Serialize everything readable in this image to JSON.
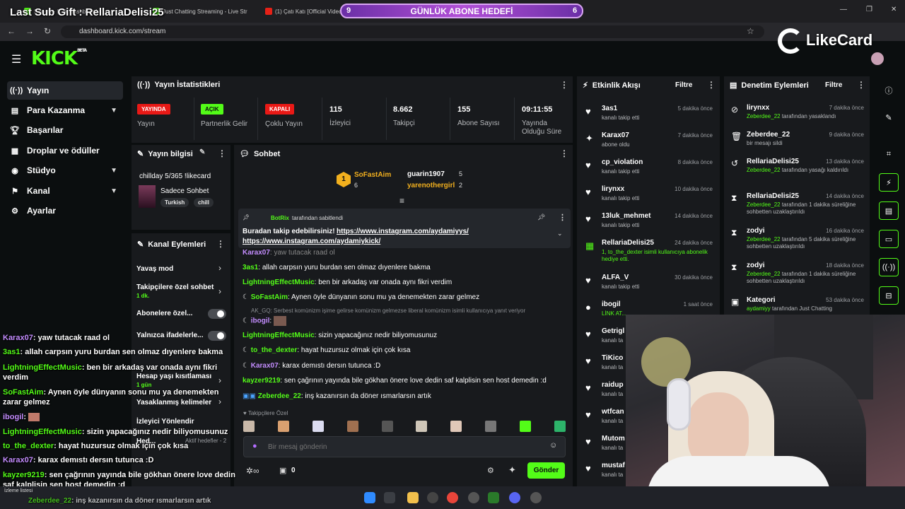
{
  "overlay": {
    "title": "Last Sub Gift : RellariaDelisi25",
    "goal_label": "GÜNLÜK ABONE HEDEFİ",
    "goal_current": "9",
    "goal_target": "6",
    "brand": "LikeCard"
  },
  "browser": {
    "tabs": [
      "Stream · Kick Dashboard",
      "Just Chatting Streaming - Live Str",
      "(1) Çatı Katı [Official Video]"
    ],
    "url": "dashboard.kick.com/stream"
  },
  "sidebar": {
    "items": [
      {
        "label": "Yayın",
        "icon": "broadcast-icon"
      },
      {
        "label": "Para Kazanma",
        "icon": "money-icon"
      },
      {
        "label": "Başarılar",
        "icon": "trophy-icon"
      },
      {
        "label": "Droplar ve ödüller",
        "icon": "gift-icon"
      },
      {
        "label": "Stüdyo",
        "icon": "studio-icon"
      },
      {
        "label": "Kanal",
        "icon": "channel-icon"
      },
      {
        "label": "Ayarlar",
        "icon": "gear-icon"
      }
    ]
  },
  "stats": {
    "title": "Yayın İstatistikleri",
    "items": [
      {
        "badge": "YAYINDA",
        "label": "Yayın",
        "color": "#e91916"
      },
      {
        "badge": "AÇIK",
        "label": "Partnerlik Gelir",
        "color": "#53fc18"
      },
      {
        "badge": "KAPALI",
        "label": "Çoklu Yayın",
        "color": "#e91916"
      },
      {
        "value": "115",
        "label": "İzleyici"
      },
      {
        "value": "8.662",
        "label": "Takipçi"
      },
      {
        "value": "155",
        "label": "Abone Sayısı"
      },
      {
        "value": "09:11:55",
        "label": "Yayında Olduğu Süre"
      }
    ]
  },
  "stream_info": {
    "title": "Yayın bilgisi",
    "stream_title": "chillday 5/365 !likecard",
    "category": "Sadece Sohbet",
    "tags": [
      "Turkish",
      "chill"
    ]
  },
  "channel_actions": {
    "title": "Kanal Eylemleri",
    "rows": [
      "Yavaş mod",
      "Takipçilere özel sohbet",
      "1 dk.",
      "Abonelere özel...",
      "Yalnızca ifadelerle...",
      "Hesap yaşı kısıtlaması",
      "1 gün",
      "Yasaklanmış kelimeler",
      "İzleyici Yönlendir",
      "Hed...",
      "Aktif hedefler - 2"
    ]
  },
  "chat": {
    "title": "Sohbet",
    "top_gifters": [
      {
        "name": "SoFastAim",
        "count": "6"
      },
      {
        "name": "guarin1907",
        "count": "5"
      },
      {
        "name": "yarenothergirl",
        "count": "2"
      }
    ],
    "pinned_by": "BotRix",
    "pinned_suffix": "tarafından sabitlendi",
    "pinned_text": "Buradan takip edebilirsiniz!",
    "pinned_link1": "https://www.instagram.com/aydamiyys/",
    "pinned_link2": "https://www.instagram.com/aydamiykick/",
    "messages": [
      {
        "user": "Karax07",
        "text": "yaw tutacak raad ol",
        "color": "#c48dff"
      },
      {
        "user": "3as1",
        "text": "allah carpsın yuru burdan sen olmaz dıyenlere bakma",
        "color": "#53fc18"
      },
      {
        "user": "LightningEffectMusic",
        "text": "ben bir arkadaş var onada aynı fikri verdim",
        "color": "#53fc18"
      },
      {
        "user": "SoFastAim",
        "text": "Aynen öyle dünyanın sonu mu ya denemekten zarar gelmez",
        "color": "#53fc18"
      },
      {
        "user": "AK_GQ",
        "text": "Serbest komünizm işime gelirse komünizm gelmezse liberal komünizm isimli kullanıcıya yanıt veriyor",
        "color": "#8a8d91"
      },
      {
        "user": "ibogil",
        "text": "",
        "color": "#c48dff"
      },
      {
        "user": "LightningEffectMusic",
        "text": "sizin yapacağınız nedir biliyomusunuz",
        "color": "#53fc18"
      },
      {
        "user": "to_the_dexter",
        "text": "hayat huzursuz olmak için çok kısa",
        "color": "#53fc18"
      },
      {
        "user": "Karax07",
        "text": "karax demıstı dersın tutunca :D",
        "color": "#c48dff"
      },
      {
        "user": "kayzer9219",
        "text": "sen çağrının yayında bile gökhan önere love dedin saf kalplisin sen host demedin :d",
        "color": "#53fc18"
      },
      {
        "user": "Zeberdee_22",
        "text": "inş kazanırsın da döner ısmarlarsın artık",
        "color": "#53fc18"
      }
    ],
    "followers_only": "Takipçilere Özel",
    "input_placeholder": "Bir mesaj gönderin",
    "points": "0",
    "send_label": "Gönder"
  },
  "overlay_chat": [
    {
      "user": "Karax07",
      "text": "yaw tutacak raad ol",
      "color": "#c48dff"
    },
    {
      "user": "3as1",
      "text": "allah carpsın yuru burdan sen olmaz dıyenlere bakma",
      "color": "#53fc18"
    },
    {
      "user": "LightningEffectMusic",
      "text": "ben bir arkadaş var onada aynı fikri verdim",
      "color": "#53fc18"
    },
    {
      "user": "SoFastAim",
      "text": "Aynen öyle dünyanın sonu mu ya denemekten zarar gelmez",
      "color": "#53fc18"
    },
    {
      "user": "ibogil",
      "text": "",
      "color": "#c48dff"
    },
    {
      "user": "LightningEffectMusic",
      "text": "sizin yapacağınız nedir biliyomusunuz",
      "color": "#53fc18"
    },
    {
      "user": "to_the_dexter",
      "text": "hayat huzursuz olmak için çok kısa",
      "color": "#53fc18"
    },
    {
      "user": "Karax07",
      "text": "karax demıstı dersın tutunca :D",
      "color": "#c48dff"
    },
    {
      "user": "kayzer9219",
      "text": "sen çağrının yayında bile gökhan önere love dedin saf kalplisin sen host demedin :d",
      "color": "#53fc18"
    },
    {
      "user": "Zeberdee_22",
      "text": "inş kazanırsın da döner ısmarlarsın artık",
      "color": "#53fc18"
    }
  ],
  "activity": {
    "title": "Etkinlik Akışı",
    "filter": "Filtre",
    "items": [
      {
        "name": "3as1",
        "sub": "kanalı takip etti",
        "time": "5 dakika önce",
        "icon": "heart-icon"
      },
      {
        "name": "Karax07",
        "sub": "abone oldu",
        "time": "7 dakika önce",
        "icon": "star-icon"
      },
      {
        "name": "cp_violation",
        "sub": "kanalı takip etti",
        "time": "8 dakika önce",
        "icon": "heart-icon"
      },
      {
        "name": "lirynxx",
        "sub": "kanalı takip etti",
        "time": "10 dakika önce",
        "icon": "heart-icon"
      },
      {
        "name": "13luk_mehmet",
        "sub": "kanalı takip etti",
        "time": "14 dakika önce",
        "icon": "heart-icon"
      },
      {
        "name": "RellariaDelisi25",
        "sub": "1, to_the_dexter isimli kullanıcıya abonelik hediye etti.",
        "time": "24 dakika önce",
        "icon": "gift-icon"
      },
      {
        "name": "ALFA_V",
        "sub": "kanalı takip etti",
        "time": "30 dakika önce",
        "icon": "heart-icon"
      },
      {
        "name": "ibogil",
        "sub": "LİNK AT...",
        "time": "1 saat önce",
        "icon": "bubble-icon"
      },
      {
        "name": "Getrigl",
        "sub": "kanalı ta",
        "time": "",
        "icon": "heart-icon"
      },
      {
        "name": "TiKico",
        "sub": "kanalı ta",
        "time": "",
        "icon": "heart-icon"
      },
      {
        "name": "raidup",
        "sub": "kanalı ta",
        "time": "",
        "icon": "heart-icon"
      },
      {
        "name": "wtfcan",
        "sub": "kanalı ta",
        "time": "",
        "icon": "heart-icon"
      },
      {
        "name": "Mutom",
        "sub": "kanalı ta",
        "time": "",
        "icon": "heart-icon"
      },
      {
        "name": "mustaf",
        "sub": "kanalı ta",
        "time": "",
        "icon": "heart-icon"
      }
    ]
  },
  "moderation": {
    "title": "Denetim Eylemleri",
    "filter": "Filtre",
    "items": [
      {
        "name": "lirynxx",
        "actor": "Zeberdee_22",
        "sub": "tarafından yasaklandı",
        "time": "7 dakika önce",
        "icon": "ban-icon"
      },
      {
        "name": "Zeberdee_22",
        "actor": "",
        "sub": "bir mesajı sildi",
        "time": "9 dakika önce",
        "icon": "trash-icon"
      },
      {
        "name": "RellariaDelisi25",
        "actor": "Zeberdee_22",
        "sub": "tarafından yasağı kaldırıldı",
        "time": "13 dakika önce",
        "icon": "undo-icon"
      },
      {
        "name": "RellariaDelisi25",
        "actor": "Zeberdee_22",
        "sub": "tarafından 1 dakika süreliğine sohbetten uzaklaştırıldı",
        "time": "14 dakika önce",
        "icon": "hourglass-icon"
      },
      {
        "name": "zodyi",
        "actor": "Zeberdee_22",
        "sub": "tarafından 5 dakika süreliğine sohbetten uzaklaştırıldı",
        "time": "16 dakika önce",
        "icon": "hourglass-icon"
      },
      {
        "name": "zodyi",
        "actor": "Zeberdee_22",
        "sub": "tarafından 1 dakika süreliğine sohbetten uzaklaştırıldı",
        "time": "18 dakika önce",
        "icon": "hourglass-icon"
      },
      {
        "name": "Kategori",
        "actor": "aydamiyy",
        "sub": "tarafından Just Chatting",
        "time": "53 dakika önce",
        "icon": "category-icon"
      }
    ]
  },
  "taskbar": {
    "watchlist": "İzleme listesi"
  }
}
